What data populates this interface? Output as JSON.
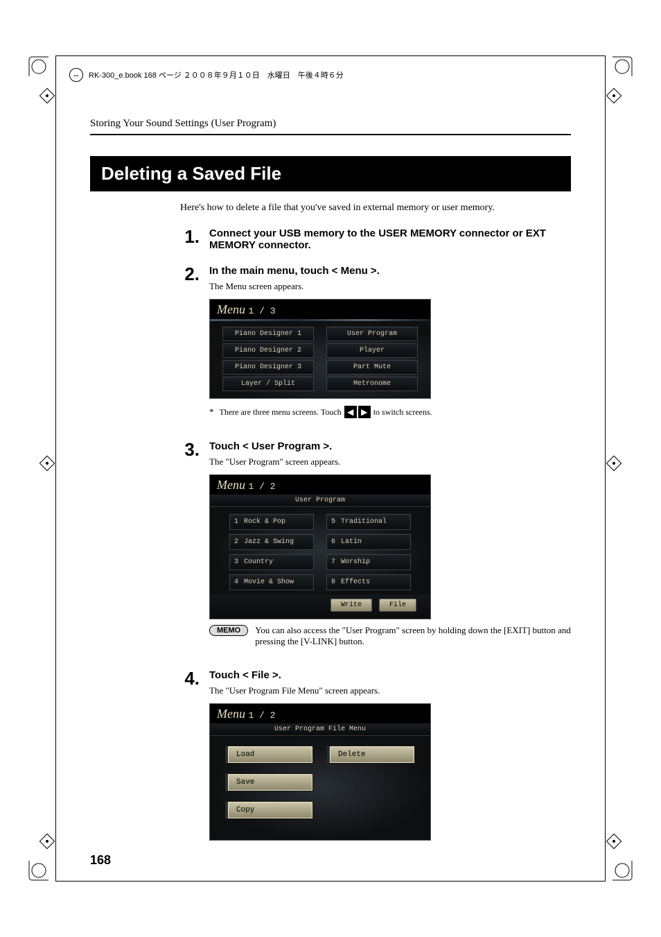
{
  "header_line": "RK-300_e.book  168 ページ  ２００８年９月１０日　水曜日　午後４時６分",
  "running_head": "Storing Your Sound Settings (User Program)",
  "section_title": "Deleting a Saved File",
  "intro": "Here's how to delete a file that you've saved in external memory or user memory.",
  "steps": {
    "s1": {
      "num": "1.",
      "heading": "Connect your USB memory to the USER MEMORY connector or EXT MEMORY connector."
    },
    "s2": {
      "num": "2.",
      "heading": "In the main menu, touch < Menu >.",
      "text": "The Menu screen appears."
    },
    "s3": {
      "num": "3.",
      "heading": "Touch < User Program >.",
      "text": "The \"User Program\" screen appears."
    },
    "s4": {
      "num": "4.",
      "heading": "Touch < File >.",
      "text": "The \"User Program File Menu\" screen appears."
    }
  },
  "menu_screen": {
    "title_prefix": "Menu",
    "title_page": "1 / 3",
    "cells": {
      "c0": "Piano Designer 1",
      "c1": "User Program",
      "c2": "Piano Designer 2",
      "c3": "Player",
      "c4": "Piano Designer 3",
      "c5": "Part Mute",
      "c6": "Layer / Split",
      "c7": "Metronome"
    }
  },
  "menu_footnote_before": "There are three menu screens. Touch ",
  "menu_footnote_after": " to switch screens.",
  "arrow_left": "◀",
  "arrow_right": "▶",
  "asterisk": "*",
  "user_program_screen": {
    "breadcrumb_prefix": "Menu",
    "breadcrumb_page": "1 / 2",
    "header": "User Program",
    "items": {
      "i1": {
        "n": "1",
        "label": "Rock & Pop"
      },
      "i2": {
        "n": "2",
        "label": "Jazz & Swing"
      },
      "i3": {
        "n": "3",
        "label": "Country"
      },
      "i4": {
        "n": "4",
        "label": "Movie & Show"
      },
      "i5": {
        "n": "5",
        "label": "Traditional"
      },
      "i6": {
        "n": "6",
        "label": "Latin"
      },
      "i7": {
        "n": "7",
        "label": "Worship"
      },
      "i8": {
        "n": "8",
        "label": "Effects"
      }
    },
    "write_btn": "Write",
    "file_btn": "File"
  },
  "memo_label": "MEMO",
  "memo_text": "You can also access the \"User Program\" screen by holding down the [EXIT] button and pressing the [V-LINK] button.",
  "file_menu_screen": {
    "breadcrumb_prefix": "Menu",
    "breadcrumb_page": "1 / 2",
    "header": "User Program File Menu",
    "load": "Load",
    "delete": "Delete",
    "save": "Save",
    "copy": "Copy"
  },
  "page_number": "168"
}
